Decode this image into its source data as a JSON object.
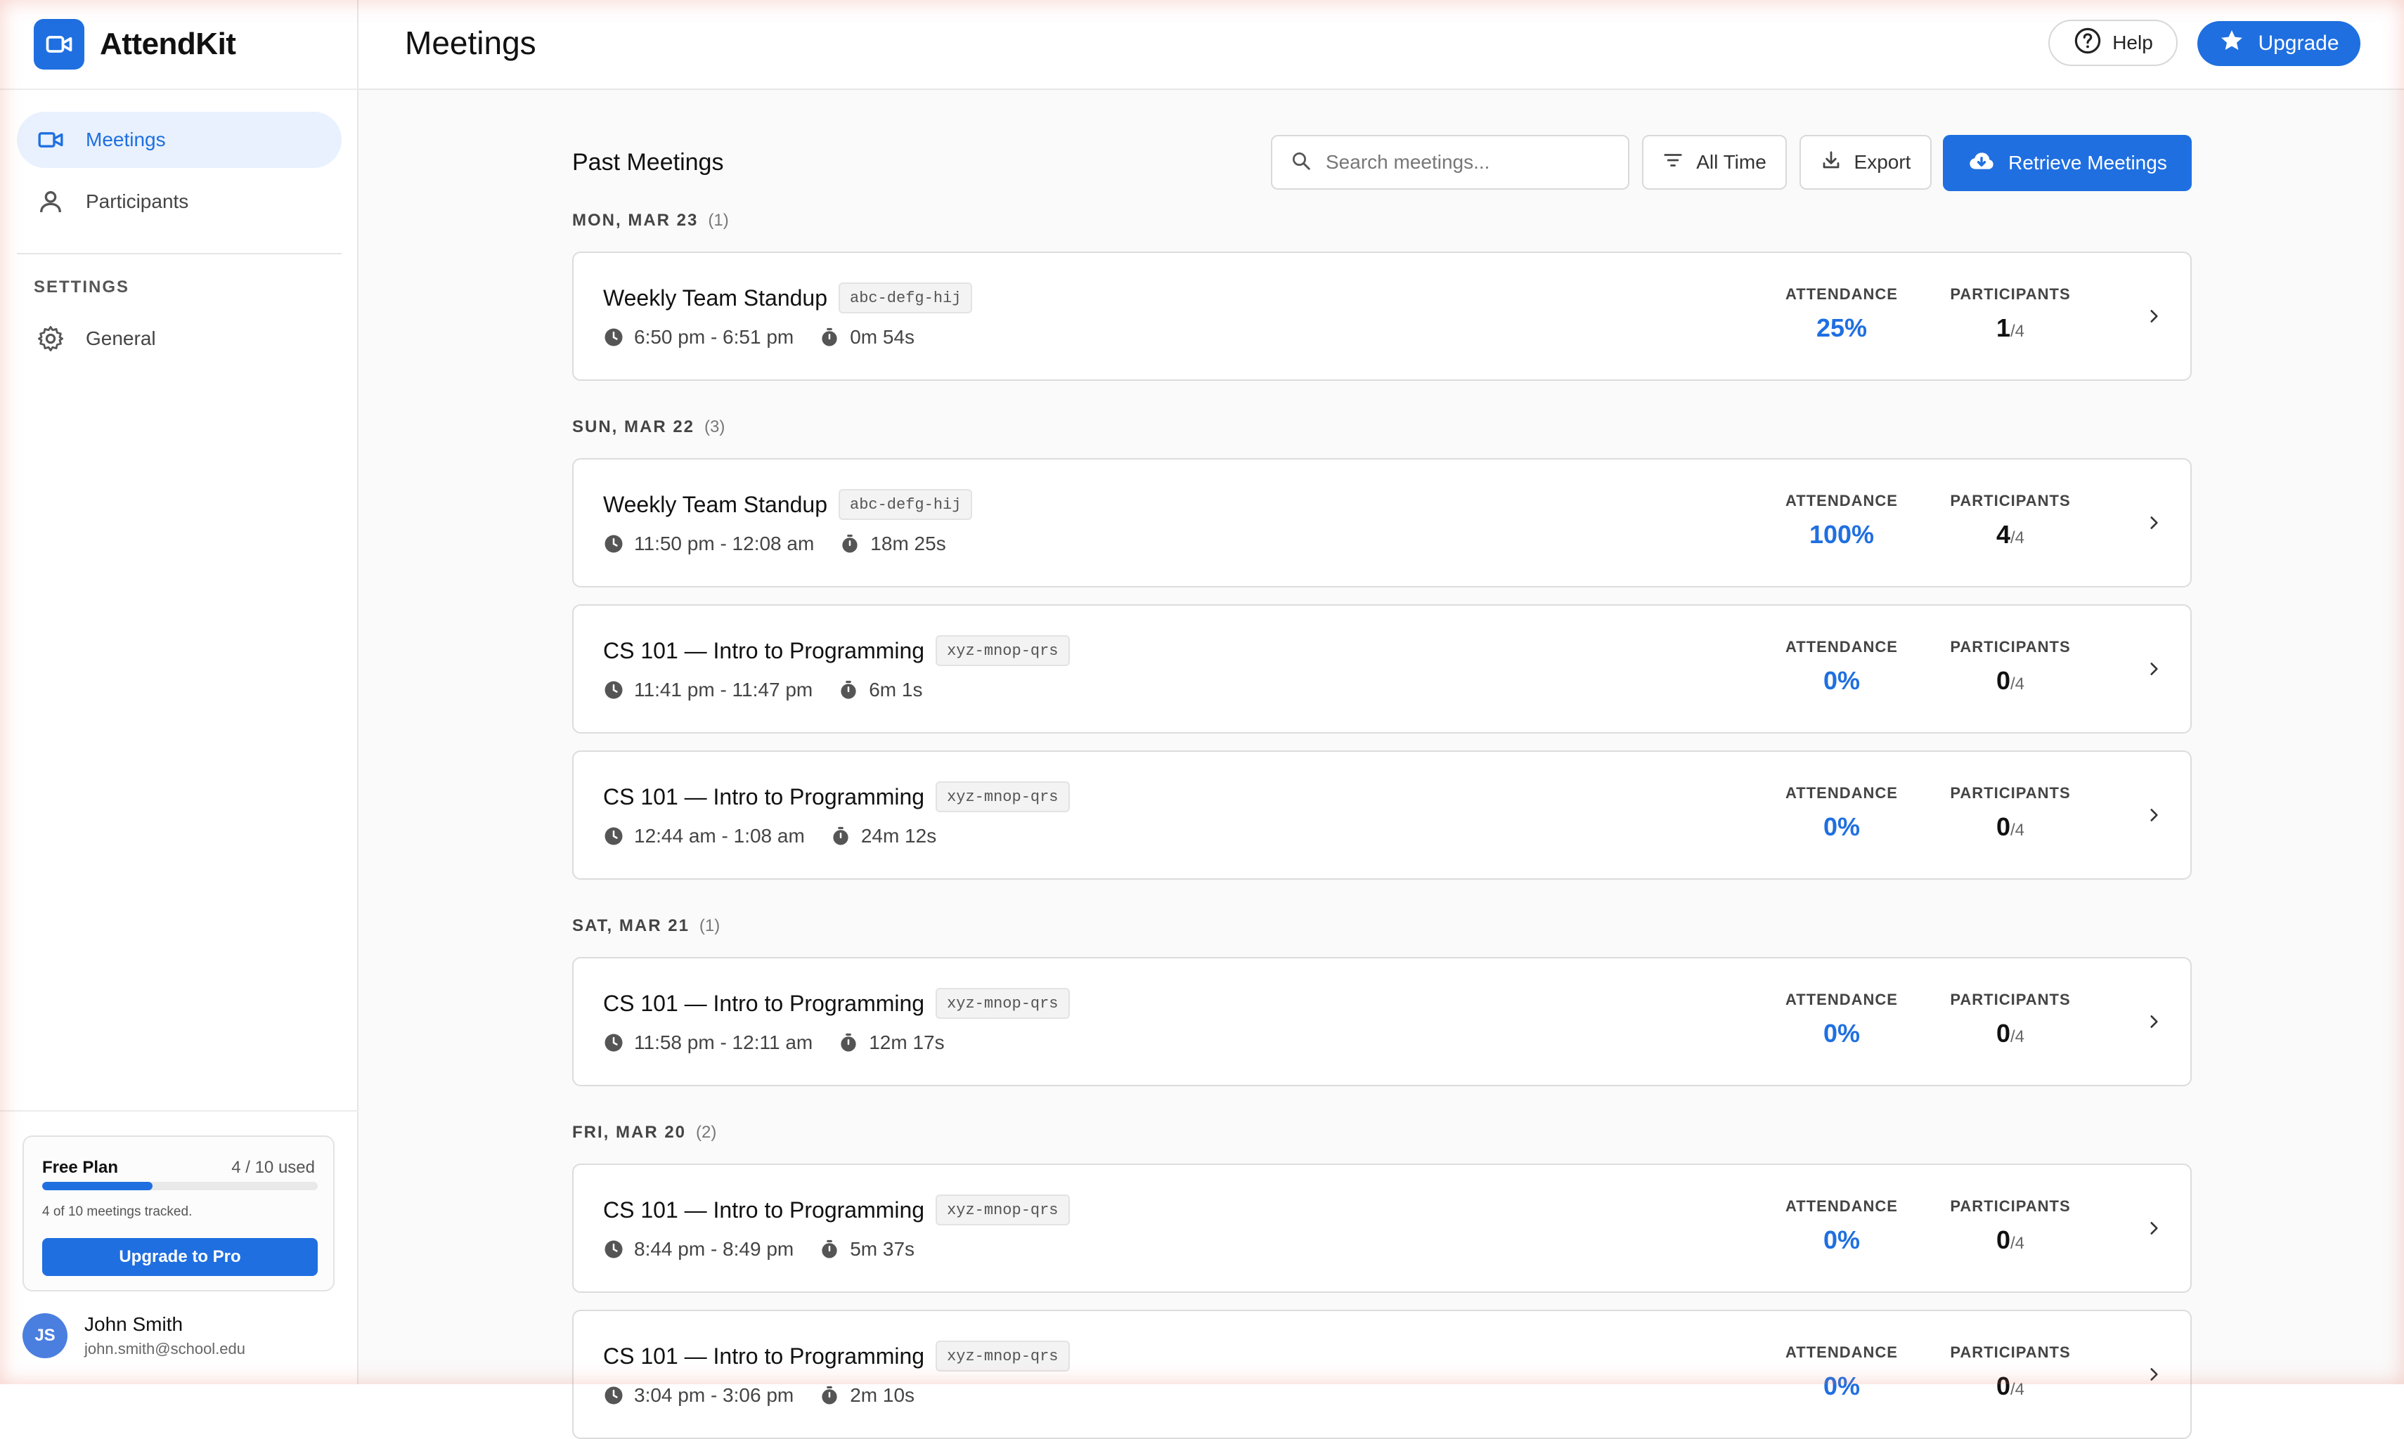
{
  "app": {
    "name": "AttendKit"
  },
  "sidebar": {
    "nav": [
      {
        "label": "Meetings",
        "icon": "video-camera-icon",
        "active": true
      },
      {
        "label": "Participants",
        "icon": "person-icon",
        "active": false
      }
    ],
    "section_label": "SETTINGS",
    "settings": [
      {
        "label": "General",
        "icon": "gear-icon"
      }
    ],
    "plan": {
      "title": "Free Plan",
      "used_label": "4 / 10 used",
      "used_fraction": 0.4,
      "note": "4 of 10 meetings tracked.",
      "upgrade_label": "Upgrade to Pro"
    },
    "user": {
      "initials": "JS",
      "name": "John Smith",
      "email": "john.smith@school.edu"
    }
  },
  "header": {
    "title": "Meetings",
    "help_label": "Help",
    "upgrade_label": "Upgrade"
  },
  "main": {
    "section_title": "Past Meetings",
    "search_placeholder": "Search meetings...",
    "filter_label": "All Time",
    "export_label": "Export",
    "retrieve_label": "Retrieve Meetings",
    "stat_labels": {
      "attendance": "ATTENDANCE",
      "participants": "PARTICIPANTS"
    },
    "groups": [
      {
        "date": "MON, MAR 23",
        "count": "(1)",
        "meetings": [
          {
            "title": "Weekly Team Standup",
            "code": "abc-defg-hij",
            "time": "6:50 pm - 6:51 pm",
            "duration": "0m 54s",
            "attendance": "25%",
            "participants": "1",
            "total": "/4"
          }
        ]
      },
      {
        "date": "SUN, MAR 22",
        "count": "(3)",
        "meetings": [
          {
            "title": "Weekly Team Standup",
            "code": "abc-defg-hij",
            "time": "11:50 pm - 12:08 am",
            "duration": "18m 25s",
            "attendance": "100%",
            "participants": "4",
            "total": "/4"
          },
          {
            "title": "CS 101 — Intro to Programming",
            "code": "xyz-mnop-qrs",
            "time": "11:41 pm - 11:47 pm",
            "duration": "6m 1s",
            "attendance": "0%",
            "participants": "0",
            "total": "/4"
          },
          {
            "title": "CS 101 — Intro to Programming",
            "code": "xyz-mnop-qrs",
            "time": "12:44 am - 1:08 am",
            "duration": "24m 12s",
            "attendance": "0%",
            "participants": "0",
            "total": "/4"
          }
        ]
      },
      {
        "date": "SAT, MAR 21",
        "count": "(1)",
        "meetings": [
          {
            "title": "CS 101 — Intro to Programming",
            "code": "xyz-mnop-qrs",
            "time": "11:58 pm - 12:11 am",
            "duration": "12m 17s",
            "attendance": "0%",
            "participants": "0",
            "total": "/4"
          }
        ]
      },
      {
        "date": "FRI, MAR 20",
        "count": "(2)",
        "meetings": [
          {
            "title": "CS 101 — Intro to Programming",
            "code": "xyz-mnop-qrs",
            "time": "8:44 pm - 8:49 pm",
            "duration": "5m 37s",
            "attendance": "0%",
            "participants": "0",
            "total": "/4"
          },
          {
            "title": "CS 101 — Intro to Programming",
            "code": "xyz-mnop-qrs",
            "time": "3:04 pm - 3:06 pm",
            "duration": "2m 10s",
            "attendance": "0%",
            "participants": "0",
            "total": "/4"
          }
        ]
      }
    ]
  },
  "colors": {
    "accent": "#1f6fe0",
    "accent_light": "#e8f1fd",
    "border": "#dcdcdc"
  }
}
